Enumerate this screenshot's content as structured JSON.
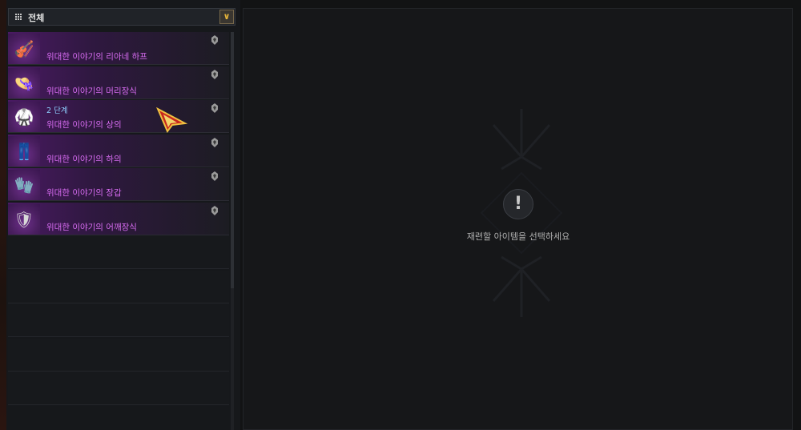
{
  "filter": {
    "label": "전체",
    "dropdown_icon": "chevron-down-icon"
  },
  "items": [
    {
      "name": "위대한 이야기의 리아네 하프",
      "stage": "",
      "thumb": "🎻"
    },
    {
      "name": "위대한 이야기의 머리장식",
      "stage": "",
      "thumb": "👒"
    },
    {
      "name": "위대한 이야기의 상의",
      "stage": "2 단계",
      "thumb": "🥋"
    },
    {
      "name": "위대한 이야기의 하의",
      "stage": "",
      "thumb": "👖"
    },
    {
      "name": "위대한 이야기의 장갑",
      "stage": "",
      "thumb": "🧤"
    },
    {
      "name": "위대한 이야기의 어깨장식",
      "stage": "",
      "thumb": "🛡"
    }
  ],
  "detail": {
    "hint": "재련할 아이템을 선택하세요",
    "warning_icon": "!"
  },
  "colors": {
    "item_name": "#d86cf2",
    "stage": "#8fd0ff",
    "accent": "#e7b53a"
  }
}
